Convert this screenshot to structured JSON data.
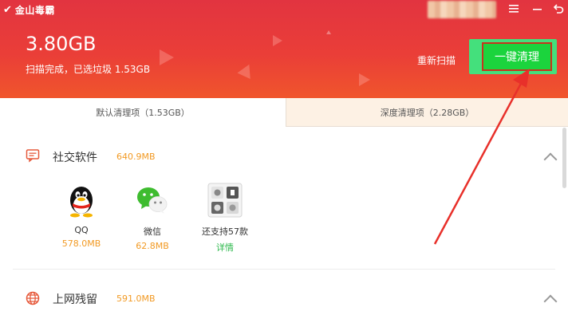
{
  "app": {
    "brand": "金山毒霸"
  },
  "header": {
    "size_value": "3.80GB",
    "status_text": "扫描完成，已选垃圾 1.53GB",
    "rescan_label": "重新扫描",
    "clean_button_label": "一键清理"
  },
  "window_controls": {
    "menu_icon": "menu-icon",
    "minimize_icon": "minimize-icon",
    "back_icon": "back-icon"
  },
  "tabs": [
    {
      "label": "默认清理项（1.53GB）"
    },
    {
      "label": "深度清理项（2.28GB）"
    }
  ],
  "sections": [
    {
      "title": "社交软件",
      "size": "640.9MB",
      "icon": "chat-icon",
      "apps": [
        {
          "name": "QQ",
          "size": "578.0MB",
          "icon": "qq-icon"
        },
        {
          "name": "微信",
          "size": "62.8MB",
          "icon": "wechat-icon"
        },
        {
          "name": "还支持57款",
          "link": "详情",
          "icon": "more-apps-icon"
        }
      ]
    },
    {
      "title": "上网残留",
      "size": "591.0MB",
      "icon": "globe-icon"
    }
  ],
  "colors": {
    "header_red": "#e23440",
    "header_orange": "#f0552c",
    "accent_green": "#1bd43d",
    "size_orange": "#f29a24",
    "link_green": "#2db84c",
    "annotation_red": "#e8302a"
  }
}
